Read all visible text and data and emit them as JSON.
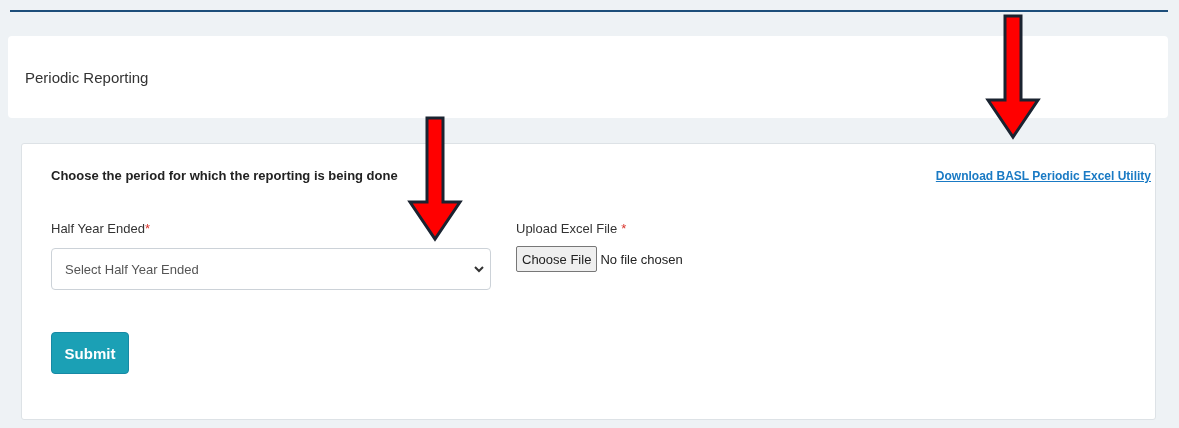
{
  "page_header": {
    "title": "Periodic Reporting"
  },
  "form": {
    "heading": "Choose the period for which the reporting is being done",
    "download_link": "Download BASL Periodic Excel Utility",
    "half_year": {
      "label": "Half Year Ended",
      "required_mark": "*",
      "placeholder": "Select Half Year Ended"
    },
    "upload": {
      "label": "Upload Excel File",
      "required_mark": "*",
      "button": "Choose File",
      "status": "No file chosen"
    },
    "submit": "Submit"
  },
  "annotations": [
    {
      "kind": "arrow"
    },
    {
      "kind": "arrow"
    }
  ]
}
